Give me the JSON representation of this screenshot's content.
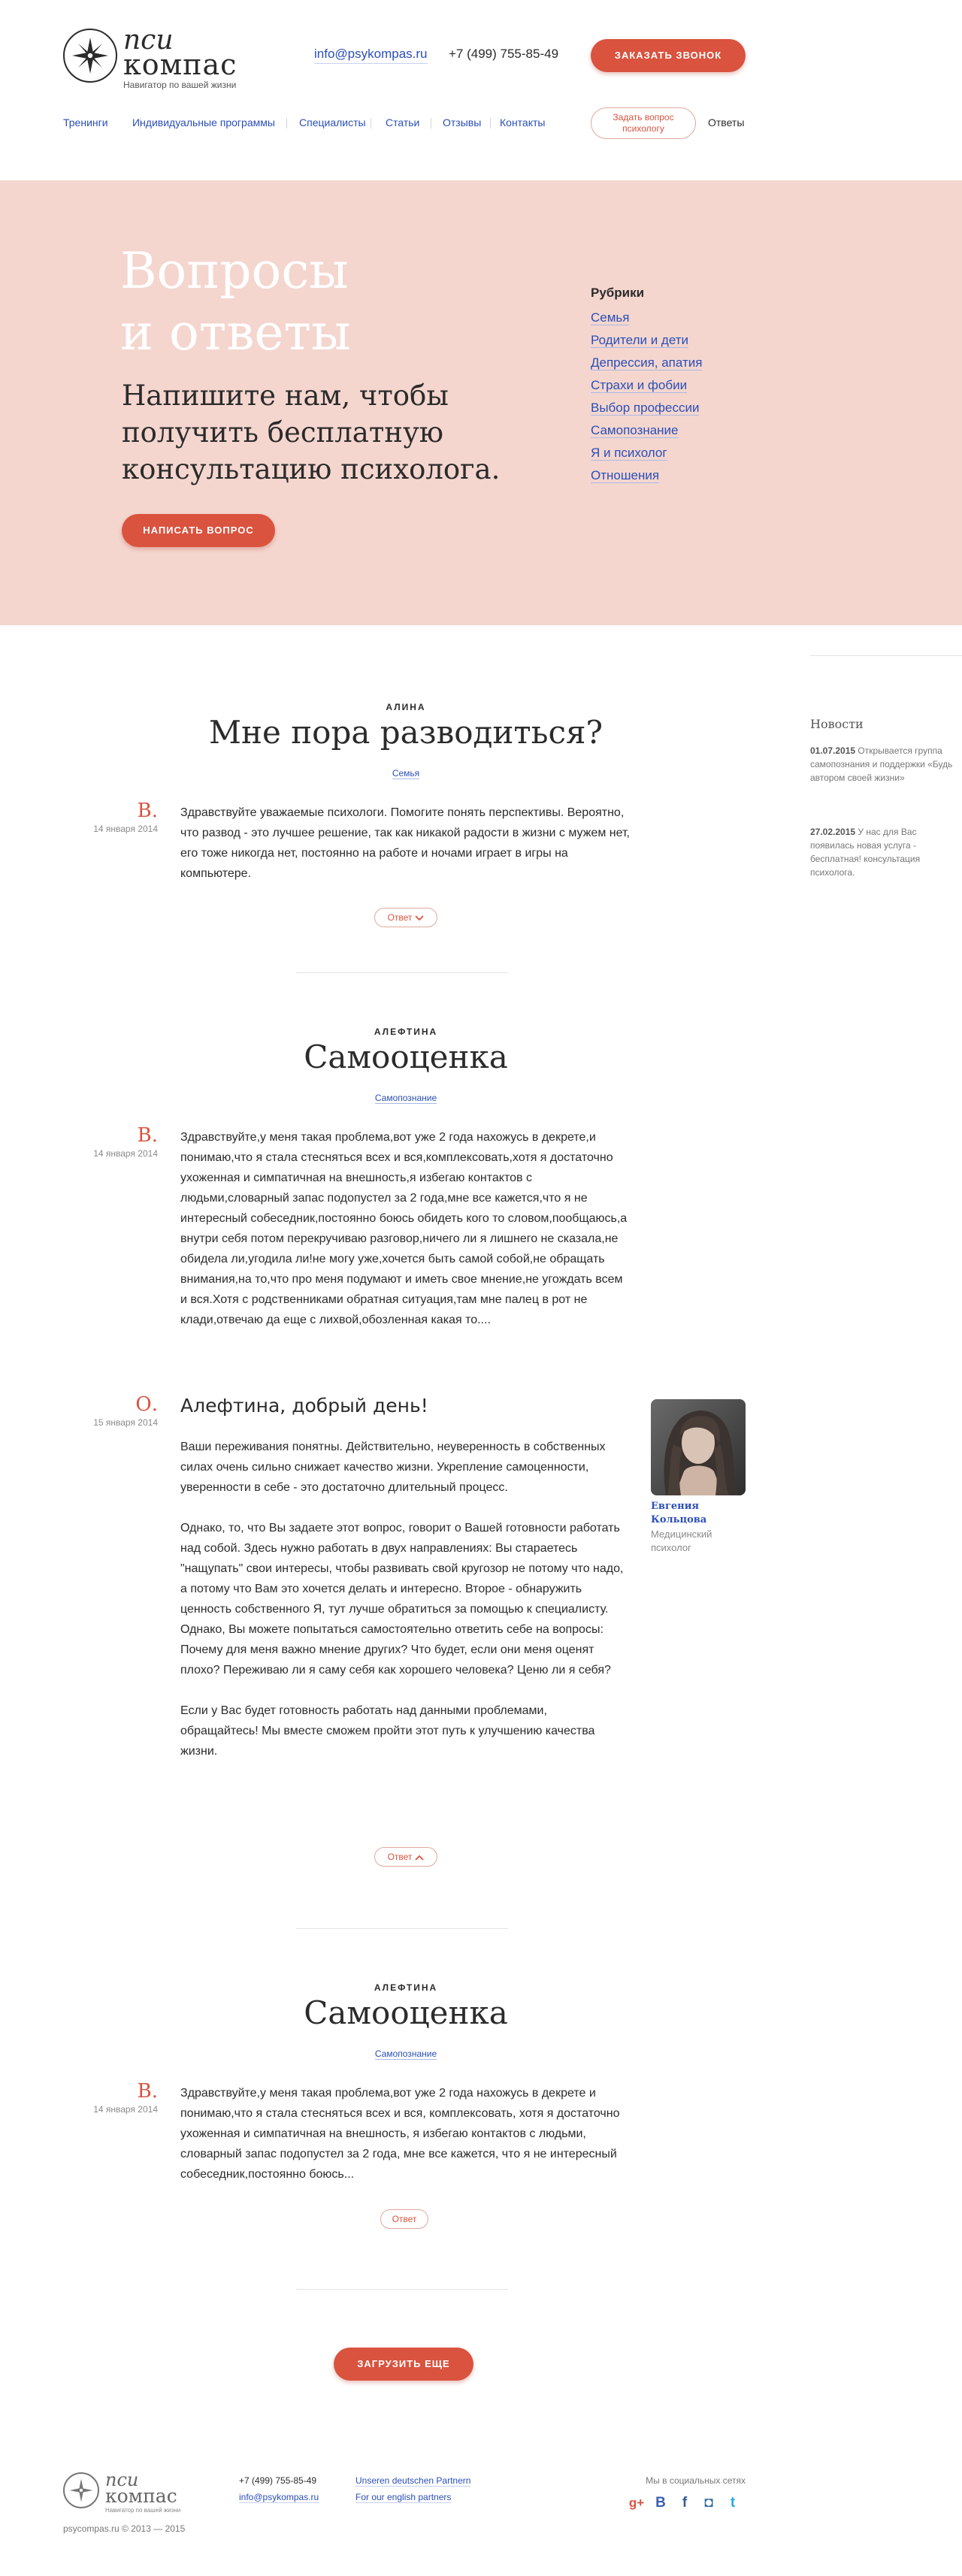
{
  "colors": {
    "accent": "#d9533f",
    "link": "#2a4fb7",
    "hero_bg": "#f4d6cf"
  },
  "header": {
    "logo": {
      "word1": "пси",
      "word2": "компас",
      "tagline": "Навигатор по вашей жизни"
    },
    "email": "info@psykompas.ru",
    "phone": "+7 (499) 755-85-49",
    "call_button": "ЗАКАЗАТЬ ЗВОНОК",
    "nav": [
      "Тренинги",
      "Индивидуальные программы",
      "Специалисты",
      "Статьи",
      "Отзывы",
      "Контакты"
    ],
    "ask_button": "Задать вопрос психологу",
    "answers_label": "Ответы"
  },
  "hero": {
    "title_line1": "Вопросы",
    "title_line2": "и ответы",
    "subtitle": "Напишите нам, чтобы получить бесплатную консультацию психолога.",
    "write_button": "НАПИСАТЬ ВОПРОС",
    "rubrics_title": "Рубрики",
    "rubrics": [
      "Семья",
      "Родители и дети",
      "Депрессия, апатия",
      "Страхи и фобии",
      "Выбор профессии",
      "Самопознание",
      "Я и психолог",
      "Отношения"
    ]
  },
  "questions": [
    {
      "author": "АЛИНА",
      "title": "Мне пора разводиться?",
      "category": "Семья",
      "letter": "В.",
      "date": "14 января 2014",
      "text": "Здравствуйте уважаемые психологи. Помогите понять перспективы. Вероятно, что развод - это лучшее решение, так как никакой радости в жизни с мужем нет, его тоже никогда нет, постоянно на работе и ночами играет в игры на компьютере.",
      "answer_button": "Ответ"
    },
    {
      "author": "АЛЕФТИНА",
      "title": "Самооценка",
      "category": "Самопознание",
      "letter": "В.",
      "date": "14 января 2014",
      "text": "Здравствуйте,у меня такая проблема,вот уже 2 года нахожусь в декрете,и понимаю,что я стала стесняться всех и вся,комплексовать,хотя я достаточно ухоженная и симпатичная на внешность,я избегаю контактов с людьми,словарный запас подопустел за 2 года,мне все кажется,что я не интересный собеседник,постоянно боюсь обидеть кого то словом,пообщаюсь,а внутри себя потом перекручиваю разговор,ничего ли я лишнего не сказала,не обидела ли,угодила ли!не могу уже,хочется быть самой собой,не обращать внимания,на то,что про меня подумают и иметь свое мнение,не угождать всем и вся.Хотя с родственниками обратная ситуация,там мне палец в рот не клади,отвечаю да еще с лихвой,обозленная какая то....",
      "answer": {
        "letter": "О.",
        "date": "15 января 2014",
        "title": "Алефтина, добрый день!",
        "paragraphs": [
          "Ваши переживания понятны. Действительно, неуверенность в собственных силах очень сильно снижает качество жизни. Укрепление самоценности, уверенности в себе - это достаточно длительный процесс.",
          "Однако, то, что Вы задаете этот вопрос, говорит о Вашей готовности работать над собой.  Здесь нужно работать в двух направлениях: Вы стараетесь \"нащупать\" свои интересы, чтобы развивать свой кругозор не потому что надо, а потому что Вам это хочется делать и интересно. Второе - обнаружить ценность собственного Я, тут лучше обратиться за помощью к специалисту. Однако, Вы можете попытаться самостоятельно ответить себе на вопросы: Почему для меня важно мнение других? Что будет, если они меня оценят плохо? Переживаю ли я саму себя как хорошего человека? Ценю ли я себя?",
          "Если у Вас будет готовность работать над данными проблемами, обращайтесь! Мы вместе сможем пройти этот путь к улучшению качества жизни."
        ],
        "psychologist_name": "Евгения Кольцова",
        "psychologist_role": "Медицинский психолог"
      },
      "answer_button": "Ответ"
    },
    {
      "author": "АЛЕФТИНА",
      "title": "Самооценка",
      "category": "Самопознание",
      "letter": "В.",
      "date": "14 января 2014",
      "text": "Здравствуйте,у меня такая проблема,вот уже 2 года нахожусь в декрете и понимаю,что я стала стесняться всех и вся, комплексовать, хотя я достаточно ухоженная и симпатичная на внешность, я избегаю контактов с людьми, словарный запас подопустел за 2 года, мне все кажется, что я не интересный собеседник,постоянно боюсь...",
      "answer_button": "Ответ"
    }
  ],
  "load_more": "ЗАГРУЗИТЬ ЕЩЕ",
  "news": {
    "title": "Новости",
    "items": [
      {
        "date": "01.07.2015",
        "text": "Открывается группа самопознания и поддержки «Будь автором своей жизни»"
      },
      {
        "date": "27.02.2015",
        "text": "У нас для Вас появилась новая услуга - бесплатная! консультация психолога."
      }
    ]
  },
  "footer": {
    "logo": {
      "word1": "пси",
      "word2": "компас",
      "tagline": "Навигатор по вашей жизни"
    },
    "copyright": "psycompas.ru © 2013 — 2015",
    "phone": "+7 (499) 755-85-49",
    "email": "info@psykompas.ru",
    "partner_link_de": "Unseren deutschen Partnern",
    "partner_link_en": "For our english partners",
    "social_label": "Мы в социальных сетях",
    "social": [
      {
        "icon": "google-plus-icon",
        "glyph": "g+",
        "color": "#d9533f"
      },
      {
        "icon": "vk-icon",
        "glyph": "В",
        "color": "#3b5fb0"
      },
      {
        "icon": "facebook-icon",
        "glyph": "f",
        "color": "#3b5998"
      },
      {
        "icon": "instagram-icon",
        "glyph": "◘",
        "color": "#356b9b"
      },
      {
        "icon": "twitter-icon",
        "glyph": "t",
        "color": "#2aa9e0"
      }
    ]
  }
}
